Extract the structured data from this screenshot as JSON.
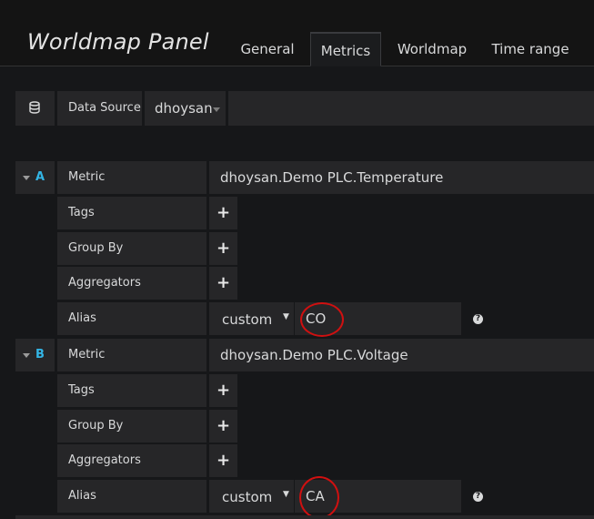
{
  "panel": {
    "title": "Worldmap Panel"
  },
  "tabs": [
    {
      "label": "General"
    },
    {
      "label": "Metrics",
      "active": true
    },
    {
      "label": "Worldmap"
    },
    {
      "label": "Time range"
    }
  ],
  "datasource": {
    "label": "Data Source",
    "value": "dhoysan",
    "icon": "database-icon"
  },
  "queries": [
    {
      "letter": "A",
      "metric_label": "Metric",
      "metric_value": "dhoysan.Demo PLC.Temperature",
      "tags_label": "Tags",
      "group_by_label": "Group By",
      "aggregators_label": "Aggregators",
      "alias_label": "Alias",
      "alias_mode": "custom",
      "alias_value": "CO",
      "help": "?"
    },
    {
      "letter": "B",
      "metric_label": "Metric",
      "metric_value": "dhoysan.Demo PLC.Voltage",
      "tags_label": "Tags",
      "group_by_label": "Group By",
      "aggregators_label": "Aggregators",
      "alias_label": "Alias",
      "alias_mode": "custom",
      "alias_value": "CA",
      "help": "?"
    }
  ],
  "colors": {
    "accent": "#33b5e5",
    "annotation": "#d01010",
    "background": "#161719",
    "cell": "#262628"
  }
}
